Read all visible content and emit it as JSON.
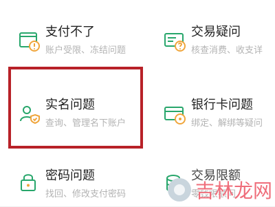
{
  "menu": {
    "items": [
      {
        "title": "支付不了",
        "subtitle": "账户受限、冻结问题",
        "icon": "warning-wallet-icon"
      },
      {
        "title": "交易疑问",
        "subtitle": "核查消费、收支详",
        "icon": "transaction-question-icon"
      },
      {
        "title": "实名问题",
        "subtitle": "查询、管理名下账户",
        "icon": "user-shield-icon"
      },
      {
        "title": "银行卡问题",
        "subtitle": "绑定、解绑等疑问",
        "icon": "bank-card-icon"
      },
      {
        "title": "密码问题",
        "subtitle": "找回、修改支付密码",
        "icon": "lock-icon"
      },
      {
        "title": "交易限额",
        "subtitle": "零钱限额问",
        "icon": "coins-icon"
      }
    ]
  },
  "watermark": {
    "logo_text": "吉林龙网",
    "small_text": ""
  },
  "colors": {
    "accent": "#27a66b",
    "highlight": "#b82128"
  }
}
